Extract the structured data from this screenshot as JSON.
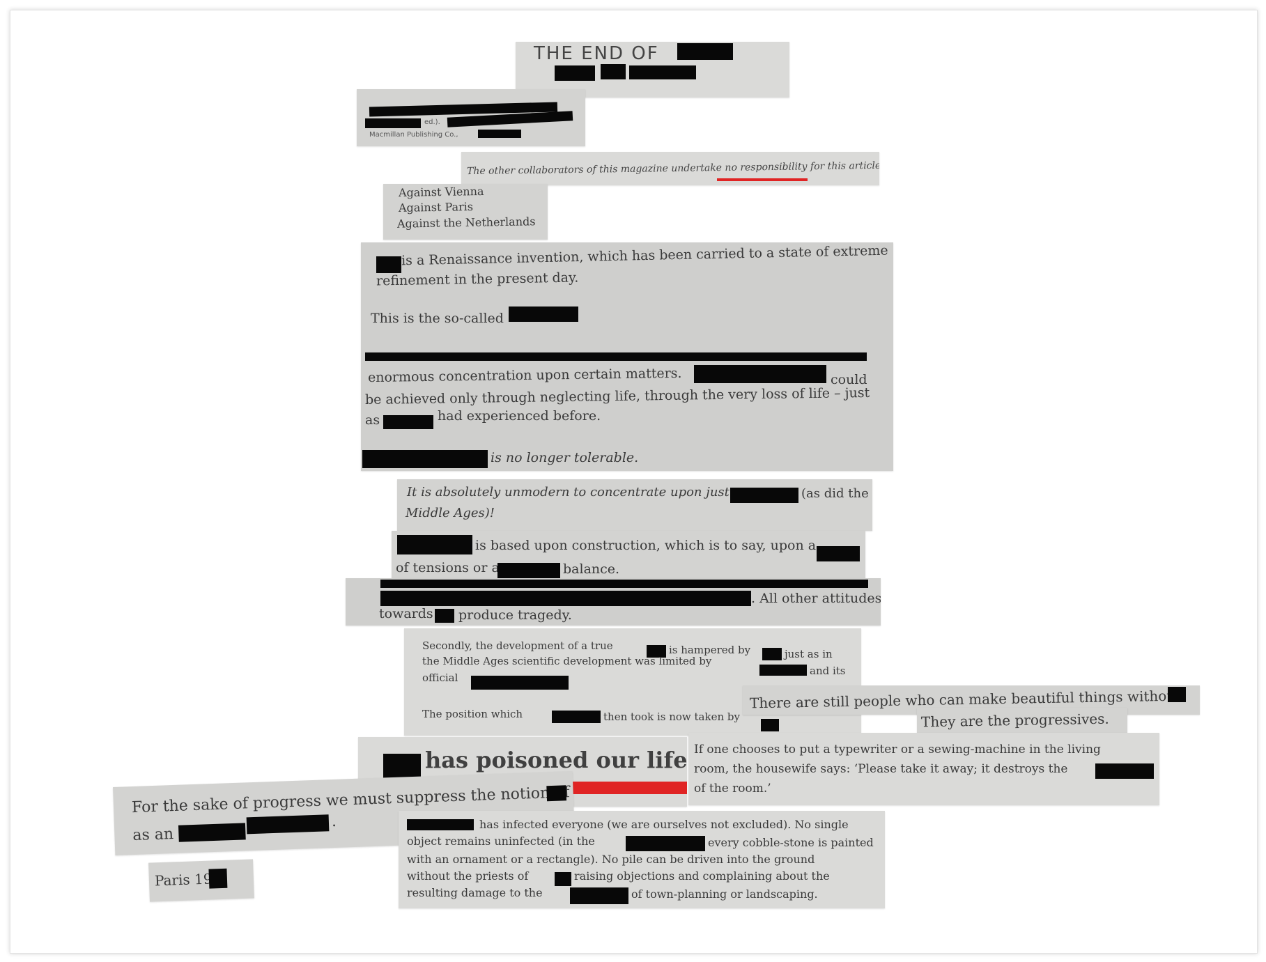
{
  "title_clip": {
    "title": "THE END OF"
  },
  "publisher_clip": {
    "fragment_ed": "ed.).",
    "publisher": "Macmillan Publishing Co.,"
  },
  "disclaimer_clip": {
    "text_before": "The other collaborators of this magazine undertake ",
    "text_underlined": "no responsibility",
    "text_after": " for this article."
  },
  "against_clip": {
    "lines": [
      "Against Vienna",
      "Against Paris",
      "Against the Netherlands"
    ]
  },
  "renaissance_clip": {
    "p1_a": " is a Renaissance invention, which has been carried to a state of extreme",
    "p1_b": "refinement in the present day.",
    "p2": "This is the so-called",
    "p3_a": "enormous concentration upon certain matters.",
    "p3_b": "could",
    "p3_c": "be achieved only through neglecting life, through the very loss of life – just",
    "p3_d": "as",
    "p3_e": "had experienced before.",
    "p4": "is no longer tolerable."
  },
  "unmodern_clip": {
    "a": "It is absolutely unmodern to concentrate upon just",
    "b": "(as did the",
    "c": "Middle Ages)!"
  },
  "construction_clip": {
    "a": "is based upon construction, which is to say, upon a",
    "b": "of tensions or a",
    "c": "balance."
  },
  "attitudes_clip": {
    "a": ". All other attitudes",
    "b": "towards",
    "c": "produce tragedy."
  },
  "secondly_clip": {
    "a": "Secondly, the development of a true",
    "b": "is hampered by",
    "c": "just as in",
    "d": "the Middle Ages scientific development was limited by",
    "e": "and its",
    "f": "official",
    "g": "The position which",
    "h": "then took is now taken by"
  },
  "still_people_clip": {
    "text": "There are still people who can make beautiful things without"
  },
  "progressives_clip": {
    "text": "They are the progressives."
  },
  "poisoned_clip": {
    "text": "has poisoned our life."
  },
  "typewriter_clip": {
    "a": "If one chooses to put a typewriter or a sewing-machine in the living",
    "b": "room, the housewife says: ‘Please take it away; it destroys the",
    "c": "of the room.’"
  },
  "progress_clip": {
    "a": "For the sake of progress we must suppress the notion of",
    "b": "as an",
    "c": "."
  },
  "paris_clip": {
    "text": "Paris 19"
  },
  "infected_clip": {
    "a": "has infected everyone (we are ourselves not excluded). No single",
    "b": "object remains uninfected (in the",
    "c": "every cobble-stone is painted",
    "d": "with an ornament or a rectangle). No pile can be driven into the ground",
    "e": "without the priests of",
    "f": "raising objections and complaining about the",
    "g": "resulting damage to the",
    "h": "of town-planning or landscaping."
  },
  "colors": {
    "paper": "#d3d3d1",
    "redaction": "#080808",
    "underline": "#e02424",
    "text": "#3a3a3a"
  }
}
